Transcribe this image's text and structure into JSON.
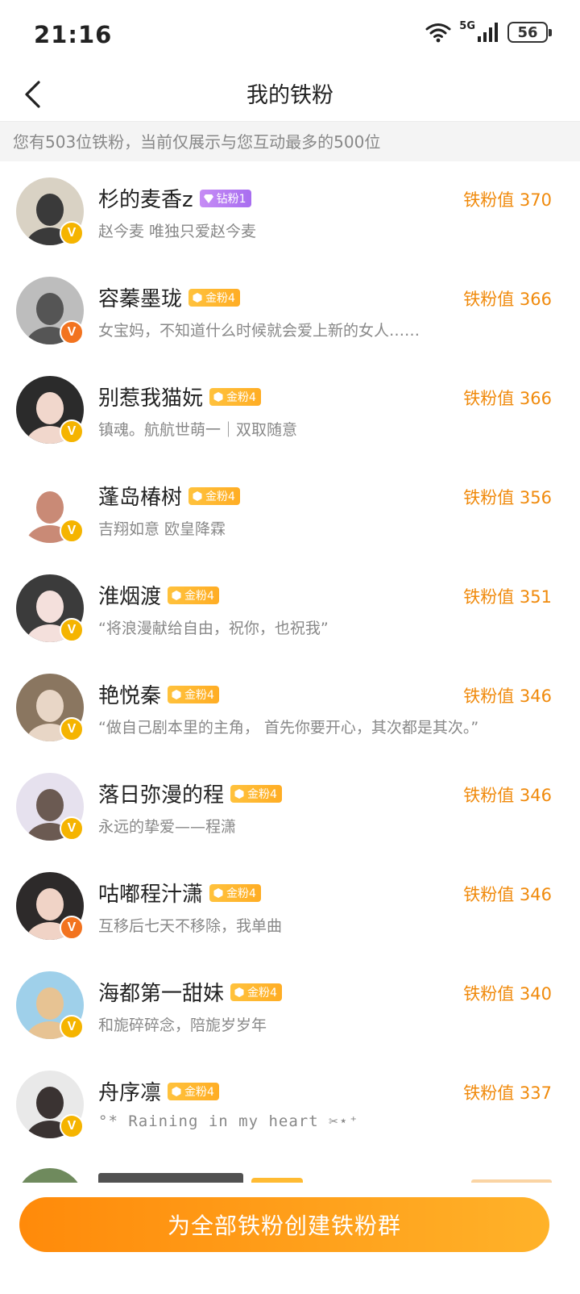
{
  "status_bar": {
    "time": "21:16",
    "network": "5G",
    "battery": "56"
  },
  "header": {
    "title": "我的铁粉"
  },
  "notice": "您有503位铁粉，当前仅展示与您互动最多的500位",
  "fans": [
    {
      "name": "杉的麦香z",
      "badge": "钻粉1",
      "badge_type": "diamond",
      "score": "铁粉值 370",
      "desc": "赵今麦 唯独只爱赵今麦",
      "verify_color": "yellow",
      "avatar_color": "#d9d2c4",
      "avatar_color2": "#3a3a3a"
    },
    {
      "name": "容蓁墨珑",
      "badge": "金粉4",
      "badge_type": "gold",
      "score": "铁粉值 366",
      "desc": "女宝妈，不知道什么时候就会爱上新的女人……",
      "verify_color": "orange",
      "avatar_color": "#bdbdbd",
      "avatar_color2": "#555555"
    },
    {
      "name": "别惹我猫妧",
      "badge": "金粉4",
      "badge_type": "gold",
      "score": "铁粉值 366",
      "desc": "镇魂。航航世萌一｜双取随意",
      "verify_color": "yellow",
      "avatar_color": "#2b2b2b",
      "avatar_color2": "#f1d7cc"
    },
    {
      "name": "蓬岛椿树",
      "badge": "金粉4",
      "badge_type": "gold",
      "score": "铁粉值 356",
      "desc": "吉翔如意 欧皇降霖",
      "verify_color": "yellow",
      "avatar_color": "#ffffff",
      "avatar_color2": "#c98a76"
    },
    {
      "name": "淮烟渡",
      "badge": "金粉4",
      "badge_type": "gold",
      "score": "铁粉值 351",
      "desc": "“将浪漫献给自由，祝你，也祝我”",
      "verify_color": "yellow",
      "avatar_color": "#3b3b3b",
      "avatar_color2": "#f4e0dc"
    },
    {
      "name": "艳悦秦",
      "badge": "金粉4",
      "badge_type": "gold",
      "score": "铁粉值 346",
      "desc": "“做自己剧本里的主角， 首先你要开心，其次都是其次。”",
      "verify_color": "yellow",
      "avatar_color": "#8a7660",
      "avatar_color2": "#e8d6c6"
    },
    {
      "name": "落日弥漫的程",
      "badge": "金粉4",
      "badge_type": "gold",
      "score": "铁粉值 346",
      "desc": "永远的挚爱——程潇",
      "verify_color": "yellow",
      "avatar_color": "#e6e1ee",
      "avatar_color2": "#6b5a52"
    },
    {
      "name": "咕嘟程汁潇",
      "badge": "金粉4",
      "badge_type": "gold",
      "score": "铁粉值 346",
      "desc": "互移后七天不移除，我单曲",
      "verify_color": "orange",
      "avatar_color": "#2d2a2a",
      "avatar_color2": "#f0d3c6"
    },
    {
      "name": "海都第一甜妹",
      "badge": "金粉4",
      "badge_type": "gold",
      "score": "铁粉值 340",
      "desc": "和旎碎碎念，陪旎岁岁年",
      "verify_color": "yellow",
      "avatar_color": "#9fd0ea",
      "avatar_color2": "#e7c393"
    },
    {
      "name": "舟序凛",
      "badge": "金粉4",
      "badge_type": "gold",
      "score": "铁粉值 337",
      "desc": "°*  Raining in my heart ✂⋆⁺",
      "verify_color": "yellow",
      "avatar_color": "#e9e9e9",
      "avatar_color2": "#3a3332"
    }
  ],
  "cta": "为全部铁粉创建铁粉群"
}
